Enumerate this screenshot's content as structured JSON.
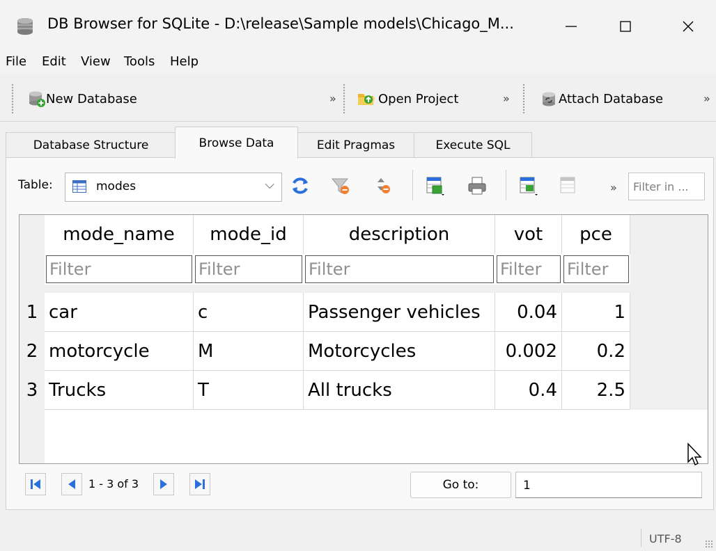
{
  "window": {
    "title": "DB Browser for SQLite - D:\\release\\Sample models\\Chicago_M..."
  },
  "menu": [
    "File",
    "Edit",
    "View",
    "Tools",
    "Help"
  ],
  "toolbar": {
    "new_database": "New Database",
    "open_project": "Open Project",
    "attach_database": "Attach Database",
    "overflow": "»"
  },
  "tabs": [
    "Database Structure",
    "Browse Data",
    "Edit Pragmas",
    "Execute SQL"
  ],
  "browse": {
    "table_label": "Table:",
    "table_name": "modes",
    "filter_placeholder": "Filter in ...",
    "columns": [
      "mode_name",
      "mode_id",
      "description",
      "vot",
      "pce"
    ],
    "filter_placeholder_col": "Filter",
    "rows": [
      {
        "n": "1",
        "mode_name": "car",
        "mode_id": "c",
        "description": "Passenger vehicles",
        "vot": "0.04",
        "pce": "1"
      },
      {
        "n": "2",
        "mode_name": "motorcycle",
        "mode_id": "M",
        "description": "Motorcycles",
        "vot": "0.002",
        "pce": "0.2"
      },
      {
        "n": "3",
        "mode_name": "Trucks",
        "mode_id": "T",
        "description": "All trucks",
        "vot": "0.4",
        "pce": "2.5"
      }
    ]
  },
  "navigation": {
    "range": "1 - 3 of 3",
    "goto_label": "Go to:",
    "goto_value": "1"
  },
  "status": {
    "encoding": "UTF-8"
  },
  "colors": {
    "nav_blue": "#2a6fdb",
    "accent_green": "#3aa335",
    "folder_yellow": "#e8b830"
  }
}
